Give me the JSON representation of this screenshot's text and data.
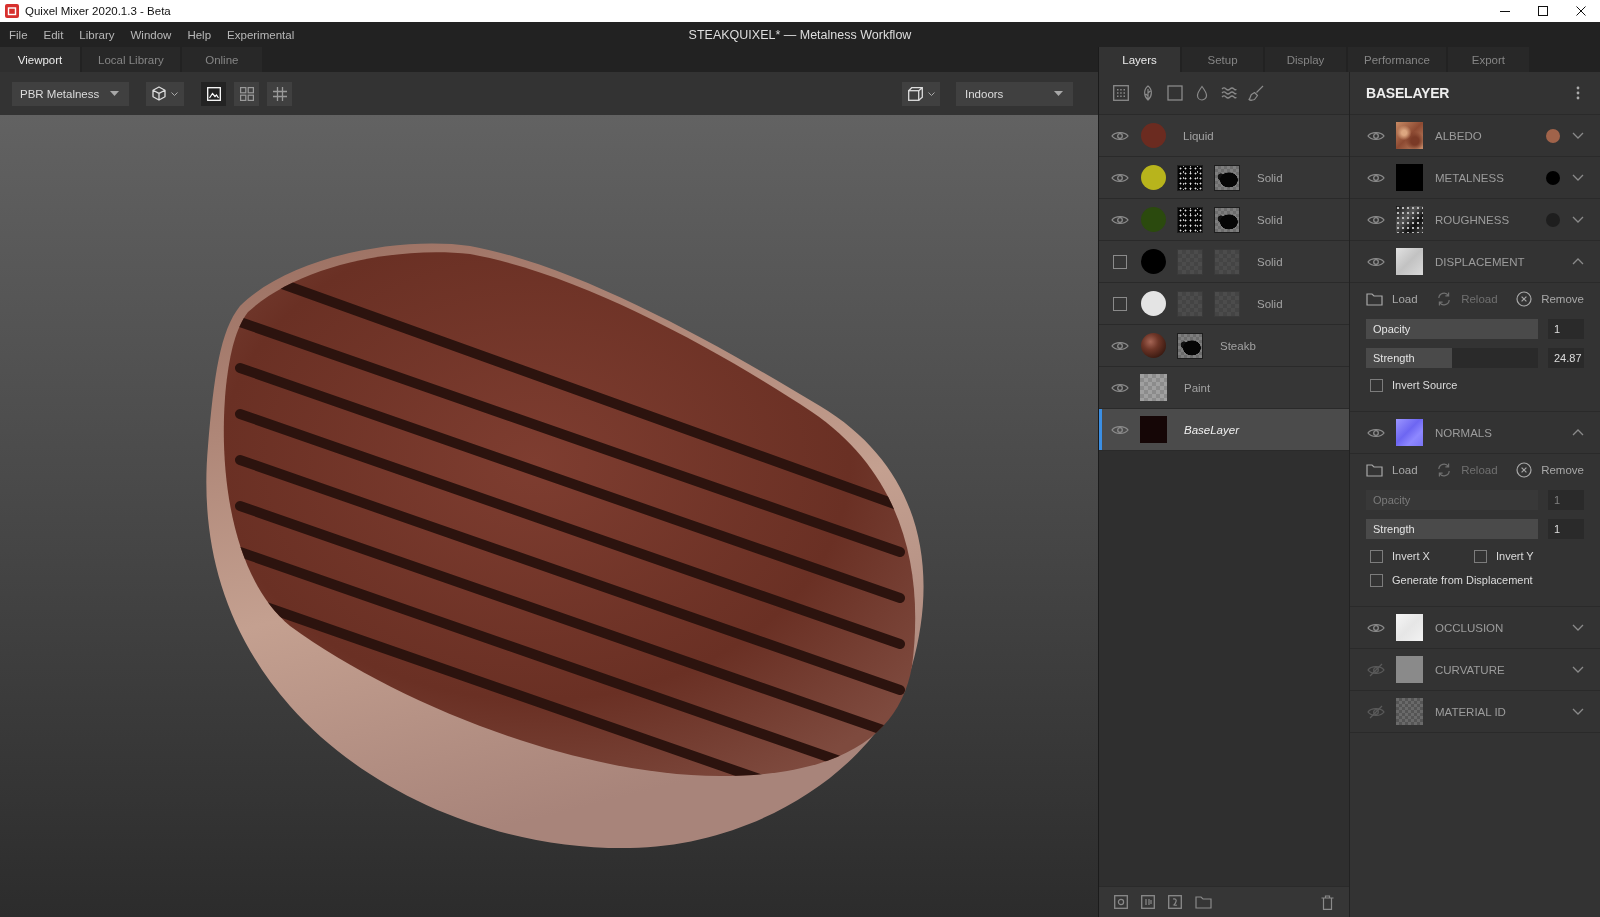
{
  "window": {
    "title": "Quixel Mixer 2020.1.3 - Beta"
  },
  "menu": [
    "File",
    "Edit",
    "Library",
    "Window",
    "Help",
    "Experimental"
  ],
  "document_title": "STEAKQUIXEL* — Metalness Workflow",
  "viewport_tabs": [
    {
      "label": "Viewport",
      "selected": true
    },
    {
      "label": "Local Library",
      "selected": false
    },
    {
      "label": "Online",
      "selected": false
    }
  ],
  "viewport_toolbar": {
    "shading_mode": "PBR Metalness",
    "view_buttons": [
      {
        "kind": "image",
        "selected": true
      },
      {
        "kind": "grid",
        "selected": false
      },
      {
        "kind": "lattice",
        "selected": false
      }
    ],
    "environment": "Indoors"
  },
  "panel_tabs": [
    {
      "label": "Layers",
      "selected": true
    },
    {
      "label": "Setup",
      "selected": false
    },
    {
      "label": "Display",
      "selected": false
    },
    {
      "label": "Performance",
      "selected": false
    },
    {
      "label": "Export",
      "selected": false
    }
  ],
  "layers": [
    {
      "name": "Liquid",
      "kind": "color",
      "color": "#6b2b20",
      "visible": true,
      "selected": false
    },
    {
      "name": "Solid",
      "kind": "color",
      "color": "#b8b41c",
      "visible": true,
      "selected": false,
      "masks": [
        {
          "kind": "speckle"
        },
        {
          "kind": "blob"
        }
      ]
    },
    {
      "name": "Solid",
      "kind": "color",
      "color": "#2b4a0e",
      "visible": true,
      "selected": false,
      "masks": [
        {
          "kind": "speckle"
        },
        {
          "kind": "blob"
        }
      ]
    },
    {
      "name": "Solid",
      "kind": "color",
      "color": "#000000",
      "visible": false,
      "selected": false,
      "masks": [
        {
          "kind": "empty"
        },
        {
          "kind": "empty"
        }
      ]
    },
    {
      "name": "Solid",
      "kind": "color",
      "color": "#e4e4e4",
      "visible": false,
      "selected": false,
      "masks": [
        {
          "kind": "empty"
        },
        {
          "kind": "empty"
        }
      ]
    },
    {
      "name": "Steakb",
      "kind": "material",
      "visible": true,
      "selected": false,
      "masks": [
        {
          "kind": "blob"
        }
      ]
    },
    {
      "name": "Paint",
      "kind": "paint",
      "visible": true,
      "selected": false
    },
    {
      "name": "BaseLayer",
      "kind": "base",
      "visible": true,
      "selected": true
    }
  ],
  "properties": {
    "title": "BASELAYER",
    "channels": [
      {
        "name": "ALBEDO",
        "kind": "albedo",
        "visible": true,
        "expanded": false,
        "color": "#a0634a"
      },
      {
        "name": "METALNESS",
        "kind": "metalness",
        "visible": true,
        "expanded": false,
        "color": "#000000"
      },
      {
        "name": "ROUGHNESS",
        "kind": "roughness",
        "visible": true,
        "expanded": false,
        "color": "#1e1e1e"
      },
      {
        "name": "DISPLACEMENT",
        "kind": "displacement",
        "visible": true,
        "expanded": true,
        "settings": {
          "actions": [
            {
              "kind": "load",
              "label": "Load",
              "disabled": false
            },
            {
              "kind": "reload",
              "label": "Reload",
              "disabled": true
            },
            {
              "kind": "remove",
              "label": "Remove",
              "disabled": false
            }
          ],
          "sliders": [
            {
              "label": "Opacity",
              "level": 1,
              "value": "1",
              "disabled": false
            },
            {
              "label": "Strength",
              "level": 0.5,
              "value": "24.87",
              "disabled": false
            }
          ],
          "checkbox_rows": [
            [
              {
                "label": "Invert Source",
                "checked": false
              }
            ]
          ]
        }
      },
      {
        "name": "NORMALS",
        "kind": "normal",
        "visible": true,
        "expanded": true,
        "settings": {
          "actions": [
            {
              "kind": "load",
              "label": "Load",
              "disabled": false
            },
            {
              "kind": "reload",
              "label": "Reload",
              "disabled": true
            },
            {
              "kind": "remove",
              "label": "Remove",
              "disabled": false
            }
          ],
          "sliders": [
            {
              "label": "Opacity",
              "level": 1,
              "value": "1",
              "disabled": true
            },
            {
              "label": "Strength",
              "level": 1,
              "value": "1",
              "disabled": false
            }
          ],
          "checkbox_rows": [
            [
              {
                "label": "Invert X",
                "checked": false
              },
              {
                "label": "Invert Y",
                "checked": false
              }
            ],
            [
              {
                "label": "Generate from Displacement",
                "checked": false
              }
            ]
          ]
        }
      },
      {
        "name": "OCCLUSION",
        "kind": "occlusion",
        "visible": true,
        "expanded": false
      },
      {
        "name": "CURVATURE",
        "kind": "flat",
        "visible": false,
        "expanded": false
      },
      {
        "name": "MATERIAL ID",
        "kind": "checker",
        "visible": false,
        "expanded": false
      }
    ]
  }
}
